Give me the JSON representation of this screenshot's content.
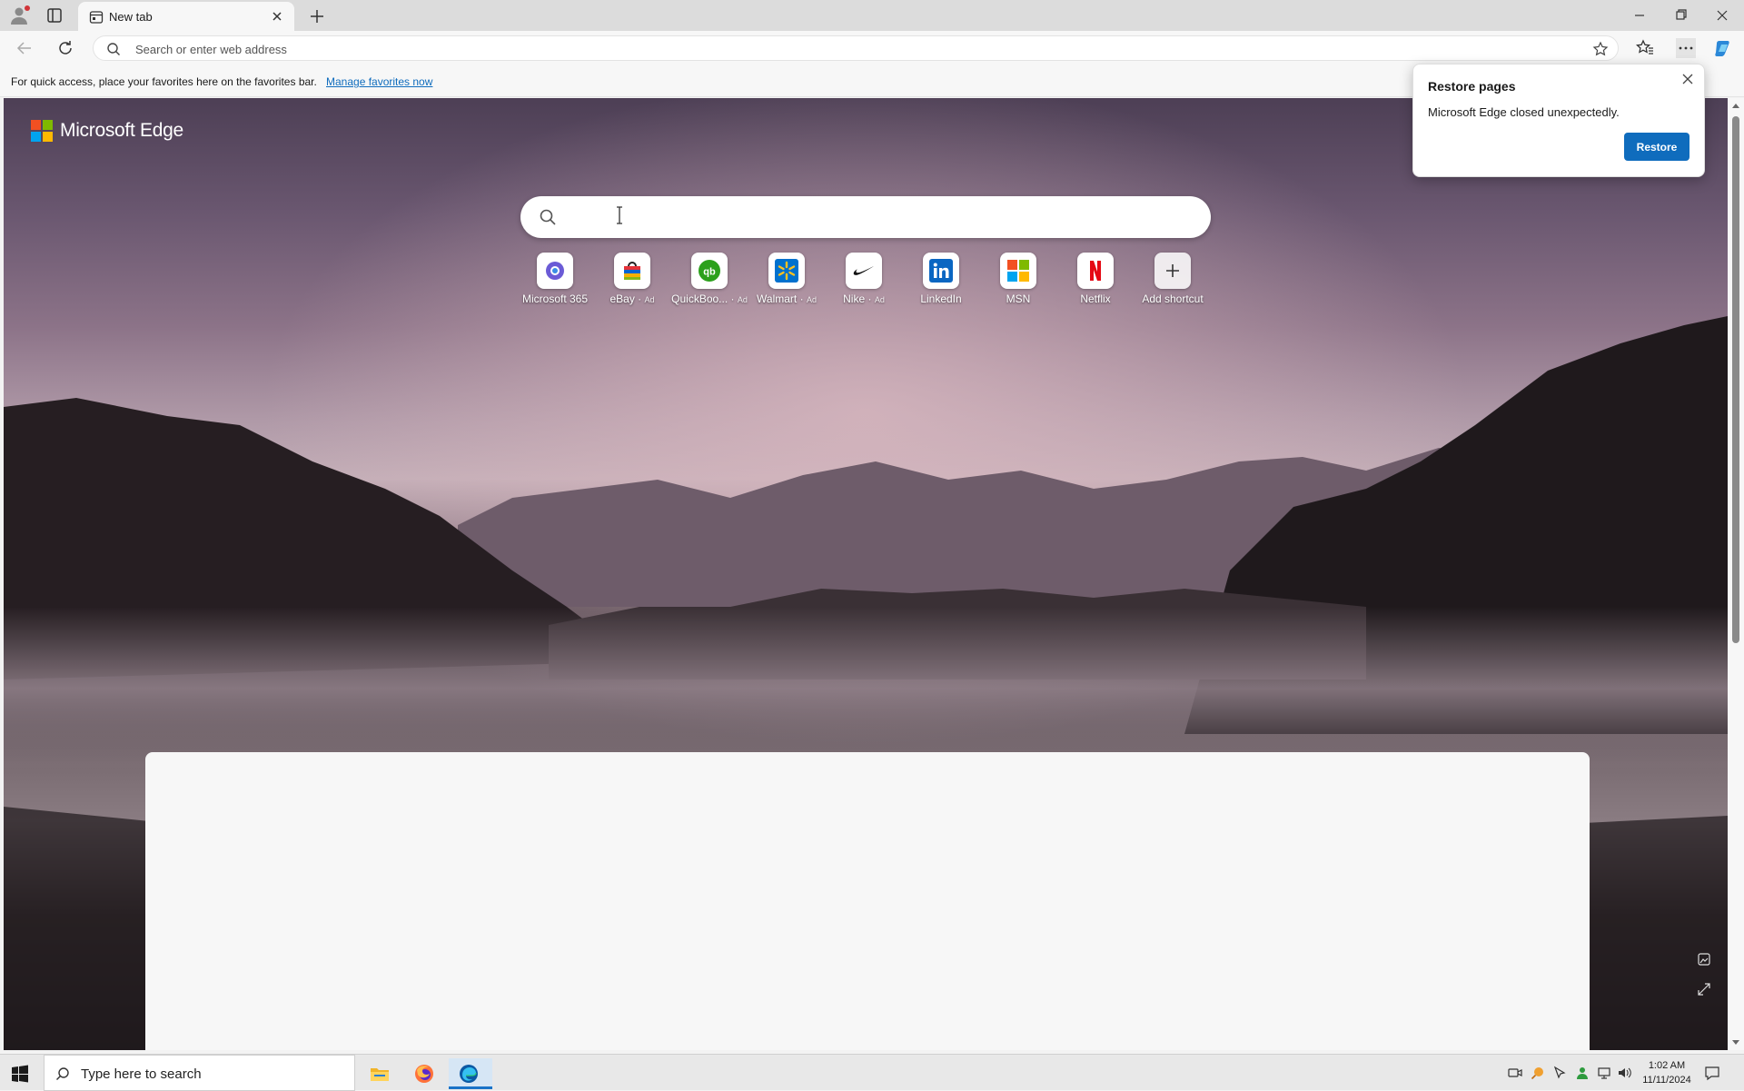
{
  "tab": {
    "title": "New tab"
  },
  "address_bar": {
    "placeholder": "Search or enter web address"
  },
  "favorites_bar": {
    "message": "For quick access, place your favorites here on the favorites bar.",
    "link": "Manage favorites now"
  },
  "page": {
    "brand": "Microsoft Edge",
    "shortcuts": [
      {
        "label": "Microsoft 365",
        "ad": "",
        "icon": "microsoft-365-icon"
      },
      {
        "label": "eBay",
        "ad": "Ad",
        "icon": "ebay-icon"
      },
      {
        "label": "QuickBoo...",
        "ad": "Ad",
        "icon": "quickbooks-icon"
      },
      {
        "label": "Walmart",
        "ad": "Ad",
        "icon": "walmart-icon"
      },
      {
        "label": "Nike",
        "ad": "Ad",
        "icon": "nike-icon"
      },
      {
        "label": "LinkedIn",
        "ad": "",
        "icon": "linkedin-icon"
      },
      {
        "label": "MSN",
        "ad": "",
        "icon": "msn-icon"
      },
      {
        "label": "Netflix",
        "ad": "",
        "icon": "netflix-icon"
      },
      {
        "label": "Add shortcut",
        "ad": "",
        "icon": "plus-icon"
      }
    ]
  },
  "restore_popup": {
    "title": "Restore pages",
    "message": "Microsoft Edge closed unexpectedly.",
    "button": "Restore"
  },
  "taskbar": {
    "search_placeholder": "Type here to search",
    "time": "1:02 AM",
    "date": "11/11/2024"
  },
  "colors": {
    "accent": "#0f6cbd",
    "link": "#0f6cbd"
  }
}
